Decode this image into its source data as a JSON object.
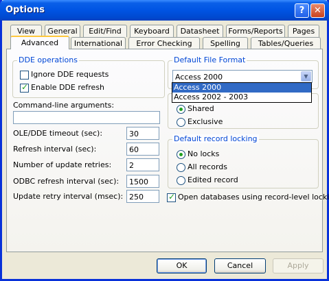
{
  "window": {
    "title": "Options"
  },
  "tabs_row1": [
    "View",
    "General",
    "Edit/Find",
    "Keyboard",
    "Datasheet",
    "Forms/Reports",
    "Pages"
  ],
  "tabs_row2": [
    "Advanced",
    "International",
    "Error Checking",
    "Spelling",
    "Tables/Queries"
  ],
  "dde": {
    "legend": "DDE operations",
    "ignore_label": "Ignore DDE requests",
    "ignore_checked": false,
    "refresh_label": "Enable DDE refresh",
    "refresh_checked": true
  },
  "cmdline": {
    "label": "Command-line arguments:",
    "value": ""
  },
  "fields": [
    {
      "label": "OLE/DDE timeout (sec):",
      "value": "30"
    },
    {
      "label": "Refresh interval (sec):",
      "value": "60"
    },
    {
      "label": "Number of update retries:",
      "value": "2"
    },
    {
      "label": "ODBC refresh interval (sec):",
      "value": "1500"
    },
    {
      "label": "Update retry interval (msec):",
      "value": "250"
    }
  ],
  "file_format": {
    "legend": "Default File Format",
    "selected": "Access 2000",
    "options": [
      "Access 2000",
      "Access 2002 - 2003"
    ]
  },
  "open_mode": {
    "shared_label": "Shared",
    "exclusive_label": "Exclusive",
    "selected": "Shared"
  },
  "locking": {
    "legend": "Default record locking",
    "options": [
      "No locks",
      "All records",
      "Edited record"
    ],
    "selected": "No locks"
  },
  "record_level": {
    "label": "Open databases using record-level locking",
    "checked": true
  },
  "buttons": {
    "ok": "OK",
    "cancel": "Cancel",
    "apply": "Apply"
  },
  "colors": {
    "title_bar": "#0054e3",
    "accent": "#0046d5",
    "selection": "#316ac5",
    "check": "#21a121"
  }
}
